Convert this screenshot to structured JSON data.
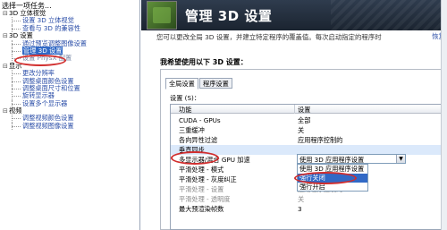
{
  "left_panel": {
    "title": "选择一项任务...",
    "tree": [
      {
        "type": "cat",
        "label": "3D 立体视觉",
        "expander": "⊟"
      },
      {
        "type": "item",
        "label": "设置 3D 立体视觉"
      },
      {
        "type": "item",
        "label": "查看与 3D 的兼容性"
      },
      {
        "type": "cat",
        "label": "3D 设置",
        "expander": "⊟"
      },
      {
        "type": "item",
        "label": "通过预览调整图像设置"
      },
      {
        "type": "item",
        "label": "管理 3D 设置",
        "selected": true
      },
      {
        "type": "item",
        "label": "设置 PhysX 配置",
        "faded": true
      },
      {
        "type": "cat",
        "label": "显示",
        "expander": "⊟"
      },
      {
        "type": "item",
        "label": "更改分辨率"
      },
      {
        "type": "item",
        "label": "调整桌面颜色设置"
      },
      {
        "type": "item",
        "label": "调整桌面尺寸和位置"
      },
      {
        "type": "item",
        "label": "旋转显示器"
      },
      {
        "type": "item",
        "label": "设置多个显示器"
      },
      {
        "type": "cat",
        "label": "视频",
        "expander": "⊟"
      },
      {
        "type": "item",
        "label": "调整视频颜色设置"
      },
      {
        "type": "item",
        "label": "调整视频图像设置"
      }
    ]
  },
  "banner": {
    "title": "管理 3D 设置"
  },
  "description": "您可以更改全局 3D 设置，并建立特定程序的覆盖值。每次启动指定的程序时",
  "restore_link": "恢复",
  "prompt": "我希望使用以下 3D 设置：",
  "tabs": [
    "全局设置",
    "程序设置"
  ],
  "settings_label": "设置 (S)：",
  "grid": {
    "col_feature": "功能",
    "col_setting": "设置",
    "rows": [
      {
        "feature": "CUDA - GPUs",
        "setting": "全部"
      },
      {
        "feature": "三重缓冲",
        "setting": "关"
      },
      {
        "feature": "各向异性过滤",
        "setting": "应用程序控制的"
      },
      {
        "feature": "垂直同步",
        "setting": ""
      },
      {
        "feature": "多显示器/混合 GPU 加速",
        "setting": ""
      },
      {
        "feature": "平滑处理 - 模式",
        "setting": ""
      },
      {
        "feature": "平滑处理 - 灰度纠正",
        "setting": ""
      },
      {
        "feature": "平滑处理 - 设置",
        "setting": "应用程序控制的"
      },
      {
        "feature": "平滑处理 - 透明度",
        "setting": "关"
      },
      {
        "feature": "最大预渲染帧数",
        "setting": "3"
      }
    ]
  },
  "dropdown": {
    "value": "使用 3D 应用程序设置",
    "arrow": "▼",
    "options": [
      "使用 3D 应用程序设置",
      "强行关闭",
      "强行开启"
    ],
    "selected_option": "强行关闭"
  }
}
